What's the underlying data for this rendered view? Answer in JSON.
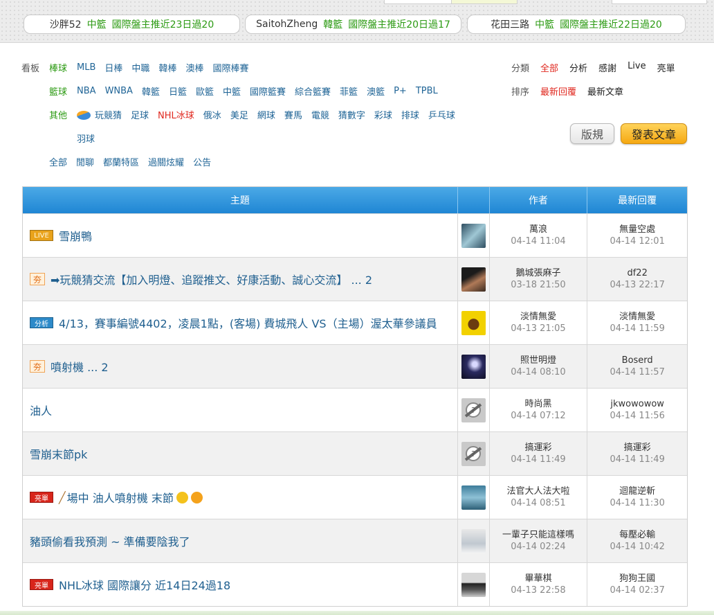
{
  "promos": [
    {
      "name": "沙胖52",
      "league": "中籃",
      "stat": "國際盤主推近23日過20"
    },
    {
      "name": "SaitohZheng",
      "league": "韓籃",
      "stat": "國際盤主推近20日過17"
    },
    {
      "name": "花田三路",
      "league": "中籃",
      "stat": "國際盤主推近22日過20"
    }
  ],
  "board_label": "看板",
  "baseball": {
    "category": "棒球",
    "items": [
      "MLB",
      "日棒",
      "中職",
      "韓棒",
      "澳棒",
      "國際棒賽"
    ]
  },
  "basketball": {
    "category": "籃球",
    "items": [
      "NBA",
      "WNBA",
      "韓籃",
      "日籃",
      "歐籃",
      "中籃",
      "國際籃賽",
      "綜合籃賽",
      "菲籃",
      "澳籃",
      "P+",
      "TPBL"
    ]
  },
  "other": {
    "category": "其他",
    "items": [
      "玩競猜",
      "足球",
      "NHL冰球",
      "俄冰",
      "美足",
      "網球",
      "賽馬",
      "電競",
      "猜數字",
      "彩球",
      "排球",
      "乒乓球"
    ],
    "items2": [
      "羽球"
    ]
  },
  "misc": {
    "items": [
      "全部",
      "閒聊",
      "都蘭特區",
      "過關炫耀",
      "公告"
    ]
  },
  "classify": {
    "label": "分類",
    "items": [
      "全部",
      "分析",
      "感謝",
      "Live",
      "亮單"
    ]
  },
  "sort": {
    "label": "排序",
    "items": [
      "最新回覆",
      "最新文章"
    ]
  },
  "buttons": {
    "rules": "版規",
    "post": "發表文章"
  },
  "table": {
    "headers": {
      "topic": "主題",
      "author": "作者",
      "reply": "最新回覆"
    },
    "rows": [
      {
        "tag": "LIVE",
        "title": "雪崩鴨",
        "author": "萬浪",
        "author_time": "04-14 11:04",
        "reply": "無量空處",
        "reply_time": "04-14 12:01"
      },
      {
        "tag": "夯",
        "title": "➡玩競猜交流【加入明燈、追蹤推文、好康活動、誠心交流】 ... 2",
        "author": "鵝城張麻子",
        "author_time": "03-18 21:50",
        "reply": "df22",
        "reply_time": "04-13 22:17"
      },
      {
        "tag": "分析",
        "title": "4/13，賽事編號4402，凌晨1點，(客場) 費城飛人 VS（主場）渥太華參議員",
        "author": "淡情無愛",
        "author_time": "04-13 21:05",
        "reply": "淡情無愛",
        "reply_time": "04-14 11:59"
      },
      {
        "tag": "夯",
        "title": "噴射機 ... 2",
        "author": "照世明燈",
        "author_time": "04-14 08:10",
        "reply": "Boserd",
        "reply_time": "04-14 11:57"
      },
      {
        "tag": "",
        "title": "油人",
        "author": "時尚黑",
        "author_time": "04-14 07:12",
        "reply": "jkwowowow",
        "reply_time": "04-14 11:56"
      },
      {
        "tag": "",
        "title": "雪崩末節pk",
        "author": "搞運彩",
        "author_time": "04-14 11:49",
        "reply": "搞運彩",
        "reply_time": "04-14 11:49"
      },
      {
        "tag": "亮單",
        "title": "場中 油人噴射機 末節",
        "author": "法官大人法大啦",
        "author_time": "04-14 08:51",
        "reply": "迴龍逆斬",
        "reply_time": "04-14 11:30"
      },
      {
        "tag": "",
        "title": "豬頭偷看我預測 ~ 準備要陰我了",
        "author": "一輩子只能這樣嗎",
        "author_time": "04-14 02:24",
        "reply": "每壓必輸",
        "reply_time": "04-14 10:42"
      },
      {
        "tag": "亮單",
        "title": "NHL冰球 國際讓分 近14日24過18",
        "author": "畢華棋",
        "author_time": "04-13 22:58",
        "reply": "狗狗王國",
        "reply_time": "04-14 02:37"
      }
    ]
  },
  "colors": {
    "header_blue": "#1f86d4",
    "category_green": "#2b9a12",
    "link_blue": "#1f6496",
    "active_red": "#e0281f",
    "post_button": "#f5a812"
  }
}
